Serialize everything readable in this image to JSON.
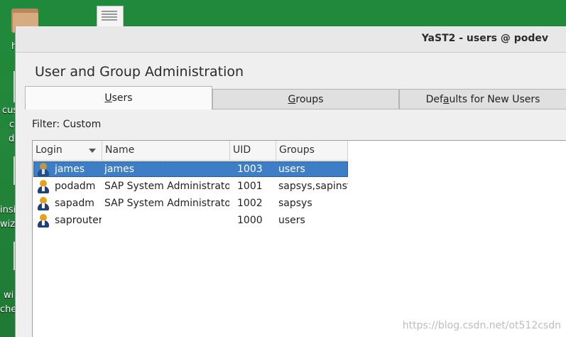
{
  "window": {
    "title": "YaST2 - users @ podev"
  },
  "heading": "User and Group Administration",
  "tabs": [
    {
      "label": "Users",
      "mnemonic": "U",
      "rest": "sers",
      "active": true
    },
    {
      "label": "Groups",
      "mnemonic": "G",
      "rest": "roups",
      "active": false
    },
    {
      "label": "Defaults for New Users",
      "pre": "Def",
      "mnemonic": "a",
      "rest": "ults for New Users",
      "active": false
    }
  ],
  "filter": "Filter: Custom",
  "table": {
    "columns": [
      "Login",
      "Name",
      "UID",
      "Groups"
    ],
    "sort_column": "Login",
    "rows": [
      {
        "login": "james",
        "name": "james",
        "uid": "1003",
        "groups": "users",
        "selected": true
      },
      {
        "login": "podadm",
        "name": "SAP System Administrator",
        "uid": "1001",
        "groups": "sapsys,sapinst",
        "selected": false
      },
      {
        "login": "sapadm",
        "name": "SAP System Administrator",
        "uid": "1002",
        "groups": "sapsys",
        "selected": false
      },
      {
        "login": "saprouter",
        "name": "",
        "uid": "1000",
        "groups": "users",
        "selected": false
      }
    ]
  },
  "desktop": {
    "fragments": [
      "h",
      "cus",
      "c",
      "d",
      "insi",
      "wiz",
      "wi",
      "che"
    ]
  },
  "watermark": "https://blog.csdn.net/ot512csdn",
  "colors": {
    "selection": "#3e7ec6",
    "desktop": "#23863a"
  }
}
